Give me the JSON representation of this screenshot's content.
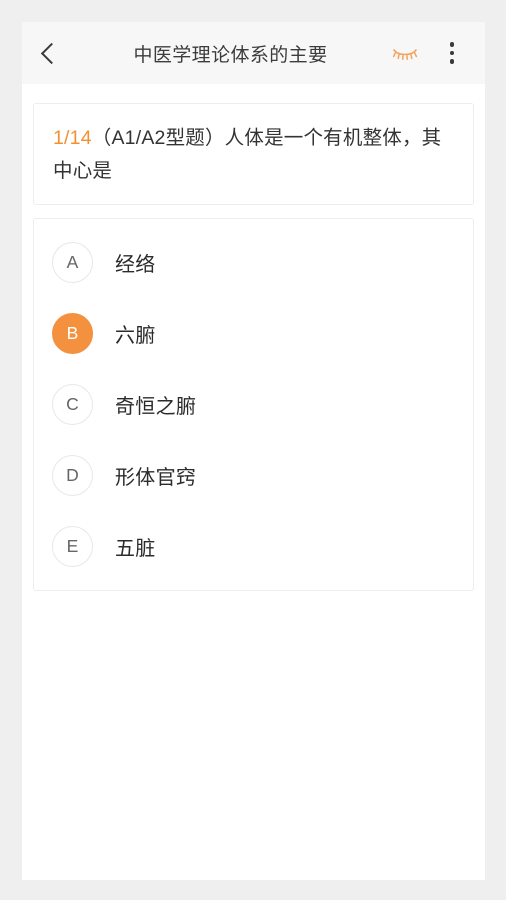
{
  "header": {
    "back_icon": "chevron-left-icon",
    "title": "中医学理论体系的主要",
    "eye_icon": "eye-closed-icon",
    "menu_icon": "more-vertical-icon",
    "accent_color": "#f3913e",
    "title_color": "#3c3c3c",
    "background": "#f7f7f7"
  },
  "question": {
    "index": "1/14",
    "text": "（A1/A2型题）人体是一个有机整体，其中心是",
    "index_color": "#f2912f"
  },
  "options": [
    {
      "letter": "A",
      "label": "经络",
      "selected": false
    },
    {
      "letter": "B",
      "label": "六腑",
      "selected": true
    },
    {
      "letter": "C",
      "label": "奇恒之腑",
      "selected": false
    },
    {
      "letter": "D",
      "label": "形体官窍",
      "selected": false
    },
    {
      "letter": "E",
      "label": "五脏",
      "selected": false
    }
  ],
  "theme": {
    "page_background": "#efefef",
    "card_background": "#ffffff",
    "card_border": "#ededed",
    "selected_color": "#f3913e"
  }
}
